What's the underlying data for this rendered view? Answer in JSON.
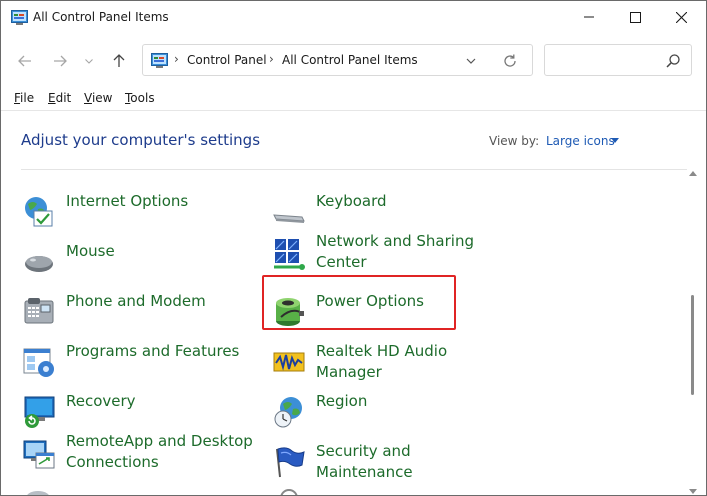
{
  "window": {
    "title": "All Control Panel Items"
  },
  "address": {
    "crumbs": [
      "Control Panel",
      "All Control Panel Items"
    ],
    "separator": "›"
  },
  "search": {
    "placeholder": ""
  },
  "menu": [
    {
      "label": "File",
      "accel": "F",
      "rest": "ile"
    },
    {
      "label": "Edit",
      "accel": "E",
      "rest": "dit"
    },
    {
      "label": "View",
      "accel": "V",
      "rest": "iew"
    },
    {
      "label": "Tools",
      "accel": "T",
      "rest": "ools"
    }
  ],
  "content": {
    "heading": "Adjust your computer's settings",
    "view_by_label": "View by:",
    "view_by_value": "Large icons"
  },
  "items": [
    {
      "label": "Internet Options",
      "icon": "internet-options-icon"
    },
    {
      "label": "Keyboard",
      "icon": "keyboard-icon"
    },
    {
      "label": "Mouse",
      "icon": "mouse-icon"
    },
    {
      "label": "Network and Sharing Center",
      "icon": "network-sharing-icon"
    },
    {
      "label": "Phone and Modem",
      "icon": "phone-modem-icon"
    },
    {
      "label": "Power Options",
      "icon": "power-options-icon",
      "highlighted": true
    },
    {
      "label": "Programs and Features",
      "icon": "programs-features-icon"
    },
    {
      "label": "Realtek HD Audio Manager",
      "icon": "realtek-audio-icon"
    },
    {
      "label": "Recovery",
      "icon": "recovery-icon"
    },
    {
      "label": "Region",
      "icon": "region-icon"
    },
    {
      "label": "RemoteApp and Desktop Connections",
      "icon": "remoteapp-icon"
    },
    {
      "label": "Security and Maintenance",
      "icon": "security-maintenance-icon"
    }
  ],
  "colors": {
    "link_green": "#1d6b2b",
    "heading_blue": "#1e3c8c",
    "highlight_red": "#e02424"
  }
}
